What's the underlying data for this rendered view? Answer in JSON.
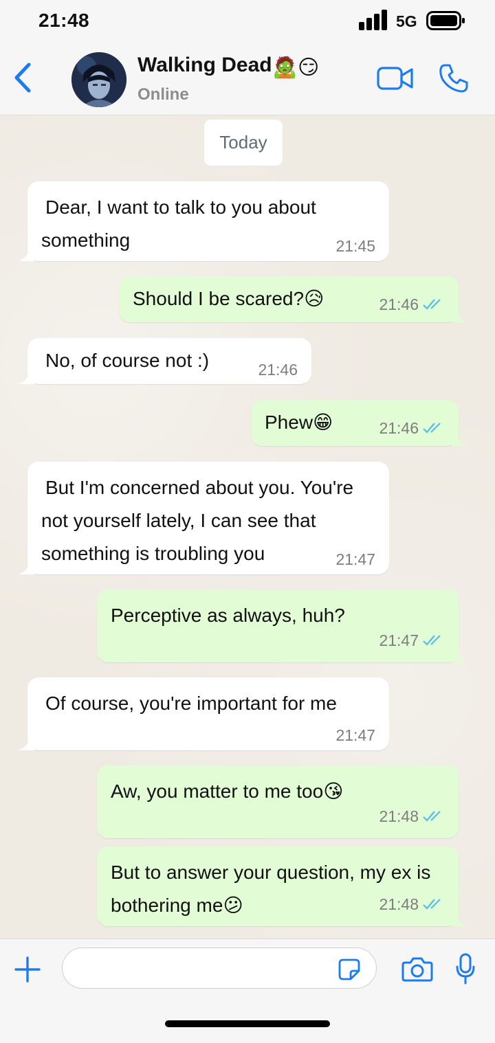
{
  "status_bar": {
    "time": "21:48",
    "network": "5G"
  },
  "header": {
    "contact_name": "Walking Dead",
    "contact_status": "Online",
    "name_emoji_1": "🧟",
    "name_emoji_2": "😏"
  },
  "chat": {
    "date_label": "Today",
    "messages": [
      {
        "direction": "in",
        "text": "Dear, I want to talk to you about something",
        "time": "21:45"
      },
      {
        "direction": "out",
        "text": "Should I be scared?",
        "emoji": "😥",
        "time": "21:46",
        "read": true
      },
      {
        "direction": "in",
        "text": "No, of course not :)",
        "time": "21:46"
      },
      {
        "direction": "out",
        "text": "Phew",
        "emoji": "😁",
        "time": "21:46",
        "read": true
      },
      {
        "direction": "in",
        "text": "But I'm concerned about you. You're not yourself lately, I can see that something is troubling you",
        "time": "21:47"
      },
      {
        "direction": "out",
        "text": "Perceptive as always, huh?",
        "time": "21:47",
        "read": true
      },
      {
        "direction": "in",
        "text": "Of course, you're important for me",
        "time": "21:47"
      },
      {
        "direction": "out",
        "text": "Aw, you matter to me too",
        "emoji": "😘",
        "time": "21:48",
        "read": true
      },
      {
        "direction": "out",
        "text": "But to answer your question, my ex is bothering me",
        "emoji": "😕",
        "time": "21:48",
        "read": true
      }
    ]
  },
  "input_bar": {
    "placeholder": ""
  },
  "colors": {
    "accent": "#1a7bf2",
    "incoming_bubble": "#ffffff",
    "outgoing_bubble": "#e2fcd5",
    "read_ticks": "#53bdeb",
    "chat_background": "#efeae2"
  },
  "icons": [
    "back-chevron-icon",
    "video-call-icon",
    "phone-icon",
    "plus-icon",
    "sticker-icon",
    "camera-icon",
    "microphone-icon",
    "read-ticks-icon",
    "signal-icon",
    "battery-icon"
  ]
}
